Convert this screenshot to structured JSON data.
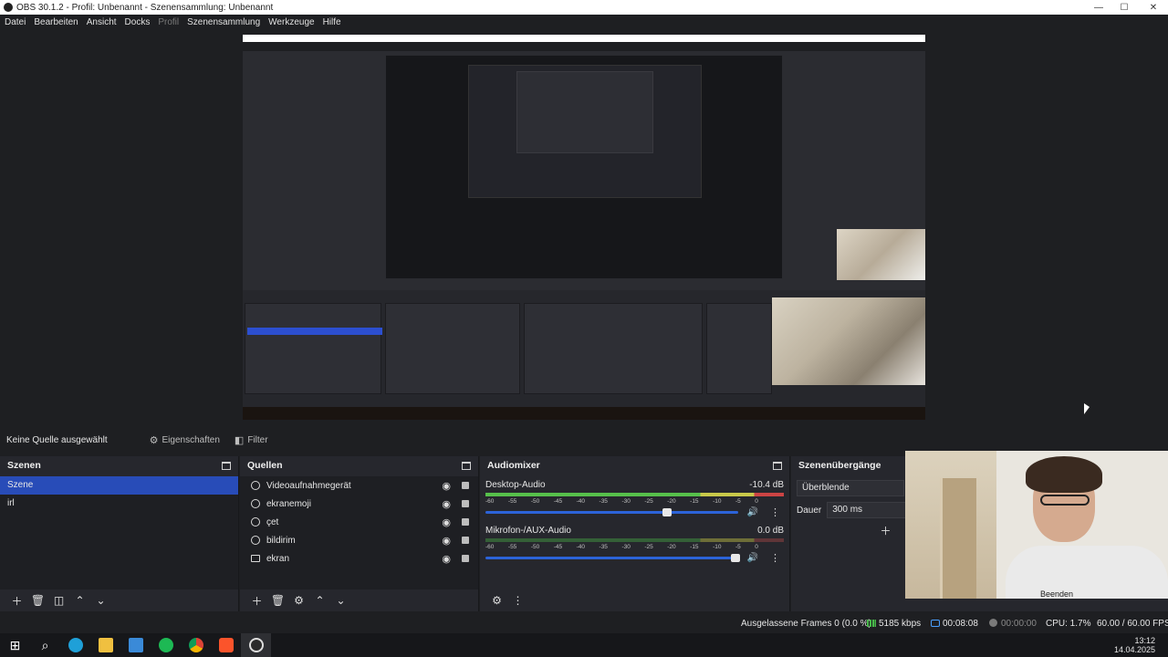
{
  "window": {
    "title": "OBS 30.1.2 - Profil: Unbenannt - Szenensammlung: Unbenannt"
  },
  "menu": {
    "items": [
      "Datei",
      "Bearbeiten",
      "Ansicht",
      "Docks",
      "Profil",
      "Szenensammlung",
      "Werkzeuge",
      "Hilfe"
    ],
    "disabled": "Profil"
  },
  "context_bar": {
    "no_source": "Keine Quelle ausgewählt",
    "properties": "Eigenschaften",
    "filters": "Filter"
  },
  "scenes": {
    "title": "Szenen",
    "items": [
      "Szene",
      "irl"
    ],
    "selected": "Szene"
  },
  "sources": {
    "title": "Quellen",
    "items": [
      {
        "name": "Videoaufnahmegerät",
        "icon": "camera-icon"
      },
      {
        "name": "ekranemoji",
        "icon": "globe-icon"
      },
      {
        "name": "çet",
        "icon": "globe-icon"
      },
      {
        "name": "bildirim",
        "icon": "globe-icon"
      },
      {
        "name": "ekran",
        "icon": "monitor-icon"
      }
    ]
  },
  "mixer": {
    "title": "Audiomixer",
    "channels": [
      {
        "name": "Desktop-Audio",
        "db": "-10.4 dB",
        "volume": 0.72,
        "active": true
      },
      {
        "name": "Mikrofon-/AUX-Audio",
        "db": "0.0 dB",
        "volume": 0.99,
        "active": false
      }
    ],
    "ticks": [
      "-60",
      "-55",
      "-50",
      "-45",
      "-40",
      "-35",
      "-30",
      "-25",
      "-20",
      "-15",
      "-10",
      "-5",
      "0"
    ]
  },
  "transitions": {
    "title": "Szenenübergänge",
    "selected": "Überblende",
    "duration_label": "Dauer",
    "duration": "300 ms"
  },
  "webcam": {
    "button": "Beenden"
  },
  "status": {
    "dropped": "Ausgelassene Frames 0 (0.0 %)",
    "bitrate": "5185 kbps",
    "live_time": "00:08:08",
    "rec_time": "00:00:00",
    "cpu": "CPU: 1.7%",
    "fps": "60.00 / 60.00 FPS"
  },
  "taskbar": {
    "time": "13:12",
    "date": "14.04.2025"
  },
  "colors": {
    "accent": "#284cb8",
    "panel": "#26272d",
    "background": "#1e1f22"
  }
}
